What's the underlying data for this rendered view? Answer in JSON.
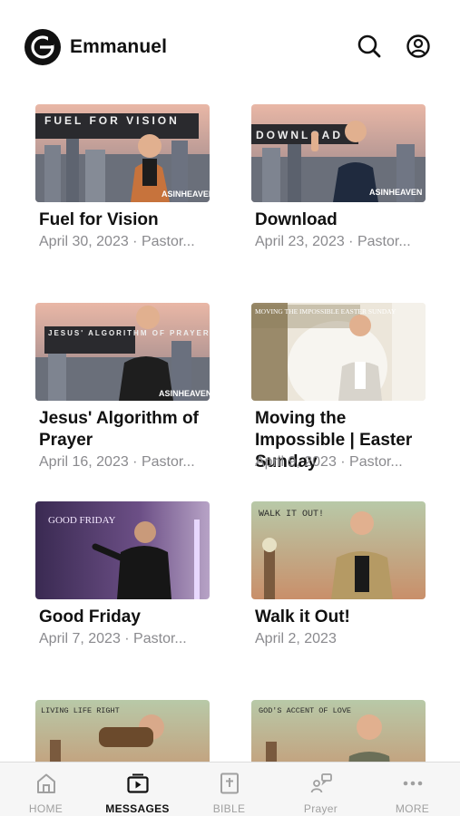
{
  "header": {
    "title": "Emmanuel",
    "logo_icon": "emmanuel-logo",
    "search_icon": "search-icon",
    "account_icon": "account-icon"
  },
  "messages": [
    {
      "title": "Fuel for Vision",
      "meta": "April 30, 2023 · Pastor...",
      "thumb_text": "FUEL FOR VISION",
      "thumb_brand": "ASINHEAVEN"
    },
    {
      "title": "Download",
      "meta": "April 23, 2023 · Pastor...",
      "thumb_text": "DOWNLOAD",
      "thumb_brand": "ASINHEAVEN"
    },
    {
      "title": "Jesus' Algorithm of Prayer",
      "meta": "April 16, 2023 · Pastor...",
      "thumb_text": "JESUS' ALGORITHM OF PRAYER",
      "thumb_brand": "ASINHEAVEN"
    },
    {
      "title": "Moving the Impossible | Easter Sunday",
      "meta": "April 9, 2023 · Pastor...",
      "thumb_text": "MOVING THE IMPOSSIBLE EASTER SUNDAY"
    },
    {
      "title": "Good Friday",
      "meta": "April 7, 2023 · Pastor...",
      "thumb_text": "GOOD FRIDAY"
    },
    {
      "title": "Walk it Out!",
      "meta": "April 2, 2023",
      "thumb_text": "WALK IT OUT!"
    },
    {
      "title": "",
      "meta": "",
      "thumb_text": "LIVING LIFE RIGHT"
    },
    {
      "title": "",
      "meta": "",
      "thumb_text": "GOD'S ACCENT OF LOVE"
    }
  ],
  "tabs": [
    {
      "label": "HOME",
      "icon": "home-icon",
      "active": false
    },
    {
      "label": "MESSAGES",
      "icon": "messages-icon",
      "active": true
    },
    {
      "label": "BIBLE",
      "icon": "bible-icon",
      "active": false
    },
    {
      "label": "Prayer",
      "icon": "prayer-icon",
      "active": false
    },
    {
      "label": "MORE",
      "icon": "more-icon",
      "active": false
    }
  ],
  "colors": {
    "accent": "#111111",
    "muted": "#8a8a8e",
    "tab_inactive": "#a0a0a0"
  }
}
